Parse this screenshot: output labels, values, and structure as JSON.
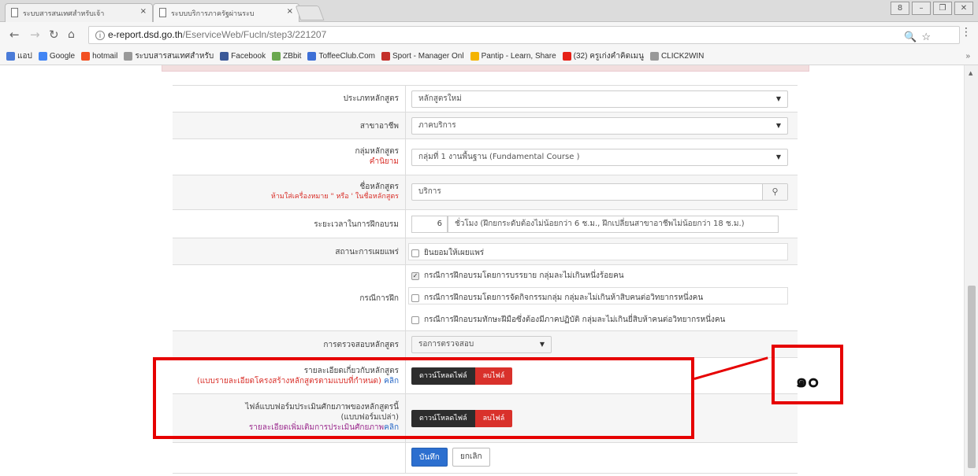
{
  "browser": {
    "tabs": [
      {
        "title": "ระบบสารสนเทศสำหรับเจ้า",
        "active": false
      },
      {
        "title": "ระบบบริการภาครัฐผ่านระบ",
        "active": true
      }
    ],
    "close_glyph": "×",
    "window_buttons": [
      "8",
      "–",
      "❐",
      "✕"
    ],
    "address": {
      "domain": "e-report.dsd.go.th",
      "path": "/EserviceWeb/Fucln/step3/221207"
    },
    "omnibox_right": "🔍☆",
    "menu_glyph": "⋮"
  },
  "bookmarks": {
    "items": [
      {
        "label": "แอป",
        "color": "#4a7bd8"
      },
      {
        "label": "Google",
        "color": "#4285f4"
      },
      {
        "label": "hotmail",
        "color": "#f25022"
      },
      {
        "label": "ระบบสารสนเทศสำหรับ",
        "color": "#999999"
      },
      {
        "label": "Facebook",
        "color": "#3b5998"
      },
      {
        "label": "ZBbit",
        "color": "#6aa84f"
      },
      {
        "label": "ToffeeClub.Com",
        "color": "#3d6fd6"
      },
      {
        "label": "Sport - Manager Onl",
        "color": "#c4302b"
      },
      {
        "label": "Pantip - Learn, Share",
        "color": "#f4b400"
      },
      {
        "label": "(32) ครูเก่งคำคิดเมนู",
        "color": "#e62117"
      },
      {
        "label": "CLICK2WIN",
        "color": "#999999"
      }
    ],
    "more": "»"
  },
  "form": {
    "course_type": {
      "label": "ประเภทหลักสูตร",
      "value": "หลักสูตรใหม่"
    },
    "branch": {
      "label": "สาขาอาชีพ",
      "value": "ภาคบริการ"
    },
    "group": {
      "label": "กลุ่มหลักสูตร",
      "note": "คำนิยาม",
      "value": "กลุ่มที่ 1 งานพื้นฐาน (Fundamental Course )"
    },
    "course_name": {
      "label": "ชื่อหลักสูตร",
      "note": "ห้ามใส่เครื่องหมาย \" หรือ ' ในชื่อหลักสูตร",
      "value": "บริการ"
    },
    "duration": {
      "label": "ระยะเวลาในการฝึกอบรม",
      "hours": "6",
      "hint": "ชั่วโมง (ฝึกยกระดับต้องไม่น้อยกว่า 6 ช.ม., ฝึกเปลี่ยนสาขาอาชีพไม่น้อยกว่า 18 ช.ม.)"
    },
    "publish": {
      "label": "สถานะการเผยแพร่",
      "option": "ยินยอมให้เผยแพร่"
    },
    "training_case": {
      "label": "กรณีการฝึก",
      "options": [
        {
          "text": "กรณีการฝึกอบรมโดยการบรรยาย กลุ่มละไม่เกินหนึ่งร้อยคน",
          "checked": true
        },
        {
          "text": "กรณีการฝึกอบรมโดยการจัดกิจกรรมกลุ่ม กลุ่มละไม่เกินห้าสิบคนต่อวิทยากรหนึ่งคน",
          "checked": false
        },
        {
          "text": "กรณีการฝึกอบรมทักษะฝีมือซึ่งต้องมีภาคปฏิบัติ กลุ่มละไม่เกินยี่สิบห้าคนต่อวิทยากรหนึ่งคน",
          "checked": false
        }
      ]
    },
    "inspection": {
      "label": "การตรวจสอบหลักสูตร",
      "value": "รอการตรวจสอบ"
    },
    "course_detail": {
      "label": "รายละเอียดเกี่ยวกับหลักสูตร",
      "note": "(แบบรายละเอียดโครงสร้างหลักสูตรตามแบบที่กำหนด)",
      "link": "คลิก",
      "download": "ดาวน์โหลดไฟล์",
      "delete": "ลบไฟล์"
    },
    "evaluation": {
      "label": "ไฟล์แบบฟอร์มประเมินศักยภาพของหลักสูตรนี้",
      "label2": "(แบบฟอร์มเปล่า)",
      "note": "รายละเอียดเพิ่มเติมการประเมินศักยภาพ",
      "link": "คลิก",
      "download": "ดาวน์โหลดไฟล์",
      "delete": "ลบไฟล์"
    },
    "save": "บันทึก",
    "cancel": "ยกเลิก"
  },
  "annotation": {
    "number": "๑๐",
    "color": "#e60000"
  }
}
